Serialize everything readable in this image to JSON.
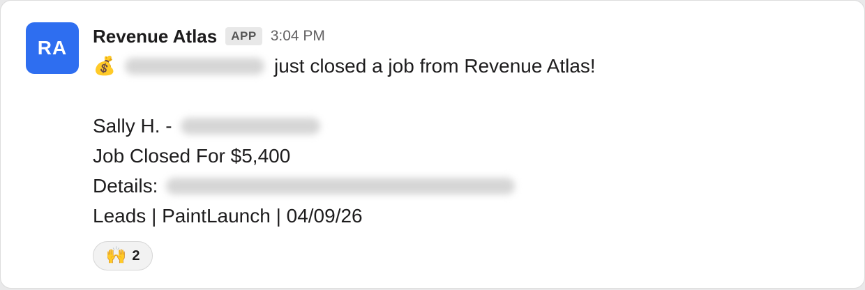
{
  "message": {
    "avatar_initials": "RA",
    "sender": "Revenue Atlas",
    "badge": "APP",
    "time": "3:04 PM",
    "intro_emoji": "💰",
    "intro_text": "just closed a job from Revenue Atlas!",
    "contact_prefix": "Sally H. -",
    "job_closed": "Job Closed For $5,400",
    "details_label": "Details:",
    "footer_line": "Leads | PaintLaunch | 04/09/26"
  },
  "reaction": {
    "emoji": "🙌",
    "count": "2"
  },
  "colors": {
    "avatar_bg": "#2e6ef0",
    "badge_bg": "#e8e8e8"
  }
}
